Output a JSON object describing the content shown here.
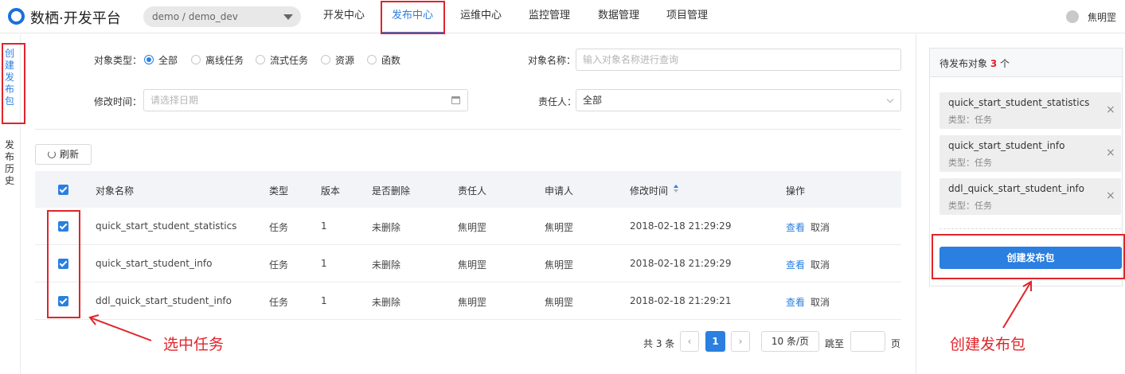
{
  "app": {
    "title": "数栖·开发平台",
    "project": "demo / demo_dev",
    "user": "焦明罡"
  },
  "nav": {
    "tabs": [
      "开发中心",
      "发布中心",
      "运维中心",
      "监控管理",
      "数据管理",
      "项目管理"
    ],
    "active": "发布中心"
  },
  "sidebar": {
    "create": "创建发布包",
    "history": "发布历史"
  },
  "filters": {
    "type_label": "对象类型：",
    "type_options": [
      "全部",
      "离线任务",
      "流式任务",
      "资源",
      "函数"
    ],
    "type_selected": "全部",
    "name_label": "对象名称：",
    "name_placeholder": "输入对象名称进行查询",
    "time_label": "修改时间：",
    "time_placeholder": "请选择日期",
    "owner_label": "责任人：",
    "owner_value": "全部"
  },
  "toolbar": {
    "refresh": "刷新"
  },
  "table": {
    "columns": [
      "对象名称",
      "类型",
      "版本",
      "是否删除",
      "责任人",
      "申请人",
      "修改时间",
      "操作"
    ],
    "rows": [
      {
        "name": "quick_start_student_statistics",
        "type": "任务",
        "version": "1",
        "deleted": "未删除",
        "owner": "焦明罡",
        "applicant": "焦明罡",
        "modified": "2018-02-18 21:29:29",
        "view": "查看",
        "cancel": "取消"
      },
      {
        "name": "quick_start_student_info",
        "type": "任务",
        "version": "1",
        "deleted": "未删除",
        "owner": "焦明罡",
        "applicant": "焦明罡",
        "modified": "2018-02-18 21:29:29",
        "view": "查看",
        "cancel": "取消"
      },
      {
        "name": "ddl_quick_start_student_info",
        "type": "任务",
        "version": "1",
        "deleted": "未删除",
        "owner": "焦明罡",
        "applicant": "焦明罡",
        "modified": "2018-02-18 21:29:21",
        "view": "查看",
        "cancel": "取消"
      }
    ]
  },
  "pagination": {
    "total": "共 3 条",
    "current": "1",
    "page_size": "10 条/页",
    "jump_label": "跳至",
    "page_unit": "页"
  },
  "pending": {
    "title": "待发布对象",
    "count": "3",
    "count_unit": "个",
    "items": [
      {
        "name": "quick_start_student_statistics",
        "type": "类型：任务"
      },
      {
        "name": "quick_start_student_info",
        "type": "类型：任务"
      },
      {
        "name": "ddl_quick_start_student_info",
        "type": "类型：任务"
      }
    ],
    "create_button": "创建发布包"
  },
  "annotations": {
    "select_tasks": "选中任务",
    "create_package": "创建发布包"
  },
  "colors": {
    "accent": "#2a7fe0",
    "annotation": "#e0242a"
  }
}
